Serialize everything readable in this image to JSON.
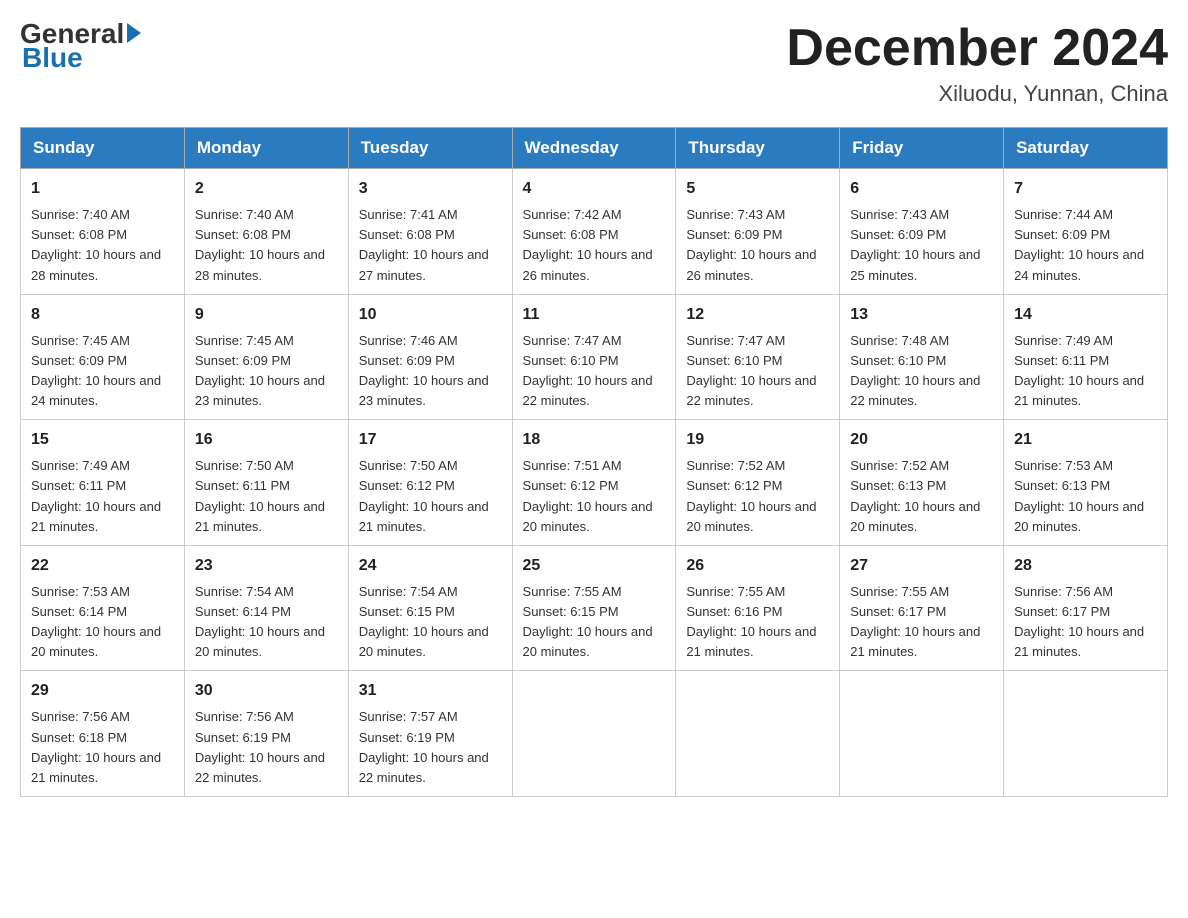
{
  "header": {
    "logo_general": "General",
    "logo_blue": "Blue",
    "month_title": "December 2024",
    "location": "Xiluodu, Yunnan, China"
  },
  "days_of_week": [
    "Sunday",
    "Monday",
    "Tuesday",
    "Wednesday",
    "Thursday",
    "Friday",
    "Saturday"
  ],
  "weeks": [
    [
      {
        "day": "1",
        "sunrise": "7:40 AM",
        "sunset": "6:08 PM",
        "daylight": "10 hours and 28 minutes."
      },
      {
        "day": "2",
        "sunrise": "7:40 AM",
        "sunset": "6:08 PM",
        "daylight": "10 hours and 28 minutes."
      },
      {
        "day": "3",
        "sunrise": "7:41 AM",
        "sunset": "6:08 PM",
        "daylight": "10 hours and 27 minutes."
      },
      {
        "day": "4",
        "sunrise": "7:42 AM",
        "sunset": "6:08 PM",
        "daylight": "10 hours and 26 minutes."
      },
      {
        "day": "5",
        "sunrise": "7:43 AM",
        "sunset": "6:09 PM",
        "daylight": "10 hours and 26 minutes."
      },
      {
        "day": "6",
        "sunrise": "7:43 AM",
        "sunset": "6:09 PM",
        "daylight": "10 hours and 25 minutes."
      },
      {
        "day": "7",
        "sunrise": "7:44 AM",
        "sunset": "6:09 PM",
        "daylight": "10 hours and 24 minutes."
      }
    ],
    [
      {
        "day": "8",
        "sunrise": "7:45 AM",
        "sunset": "6:09 PM",
        "daylight": "10 hours and 24 minutes."
      },
      {
        "day": "9",
        "sunrise": "7:45 AM",
        "sunset": "6:09 PM",
        "daylight": "10 hours and 23 minutes."
      },
      {
        "day": "10",
        "sunrise": "7:46 AM",
        "sunset": "6:09 PM",
        "daylight": "10 hours and 23 minutes."
      },
      {
        "day": "11",
        "sunrise": "7:47 AM",
        "sunset": "6:10 PM",
        "daylight": "10 hours and 22 minutes."
      },
      {
        "day": "12",
        "sunrise": "7:47 AM",
        "sunset": "6:10 PM",
        "daylight": "10 hours and 22 minutes."
      },
      {
        "day": "13",
        "sunrise": "7:48 AM",
        "sunset": "6:10 PM",
        "daylight": "10 hours and 22 minutes."
      },
      {
        "day": "14",
        "sunrise": "7:49 AM",
        "sunset": "6:11 PM",
        "daylight": "10 hours and 21 minutes."
      }
    ],
    [
      {
        "day": "15",
        "sunrise": "7:49 AM",
        "sunset": "6:11 PM",
        "daylight": "10 hours and 21 minutes."
      },
      {
        "day": "16",
        "sunrise": "7:50 AM",
        "sunset": "6:11 PM",
        "daylight": "10 hours and 21 minutes."
      },
      {
        "day": "17",
        "sunrise": "7:50 AM",
        "sunset": "6:12 PM",
        "daylight": "10 hours and 21 minutes."
      },
      {
        "day": "18",
        "sunrise": "7:51 AM",
        "sunset": "6:12 PM",
        "daylight": "10 hours and 20 minutes."
      },
      {
        "day": "19",
        "sunrise": "7:52 AM",
        "sunset": "6:12 PM",
        "daylight": "10 hours and 20 minutes."
      },
      {
        "day": "20",
        "sunrise": "7:52 AM",
        "sunset": "6:13 PM",
        "daylight": "10 hours and 20 minutes."
      },
      {
        "day": "21",
        "sunrise": "7:53 AM",
        "sunset": "6:13 PM",
        "daylight": "10 hours and 20 minutes."
      }
    ],
    [
      {
        "day": "22",
        "sunrise": "7:53 AM",
        "sunset": "6:14 PM",
        "daylight": "10 hours and 20 minutes."
      },
      {
        "day": "23",
        "sunrise": "7:54 AM",
        "sunset": "6:14 PM",
        "daylight": "10 hours and 20 minutes."
      },
      {
        "day": "24",
        "sunrise": "7:54 AM",
        "sunset": "6:15 PM",
        "daylight": "10 hours and 20 minutes."
      },
      {
        "day": "25",
        "sunrise": "7:55 AM",
        "sunset": "6:15 PM",
        "daylight": "10 hours and 20 minutes."
      },
      {
        "day": "26",
        "sunrise": "7:55 AM",
        "sunset": "6:16 PM",
        "daylight": "10 hours and 21 minutes."
      },
      {
        "day": "27",
        "sunrise": "7:55 AM",
        "sunset": "6:17 PM",
        "daylight": "10 hours and 21 minutes."
      },
      {
        "day": "28",
        "sunrise": "7:56 AM",
        "sunset": "6:17 PM",
        "daylight": "10 hours and 21 minutes."
      }
    ],
    [
      {
        "day": "29",
        "sunrise": "7:56 AM",
        "sunset": "6:18 PM",
        "daylight": "10 hours and 21 minutes."
      },
      {
        "day": "30",
        "sunrise": "7:56 AM",
        "sunset": "6:19 PM",
        "daylight": "10 hours and 22 minutes."
      },
      {
        "day": "31",
        "sunrise": "7:57 AM",
        "sunset": "6:19 PM",
        "daylight": "10 hours and 22 minutes."
      },
      null,
      null,
      null,
      null
    ]
  ]
}
